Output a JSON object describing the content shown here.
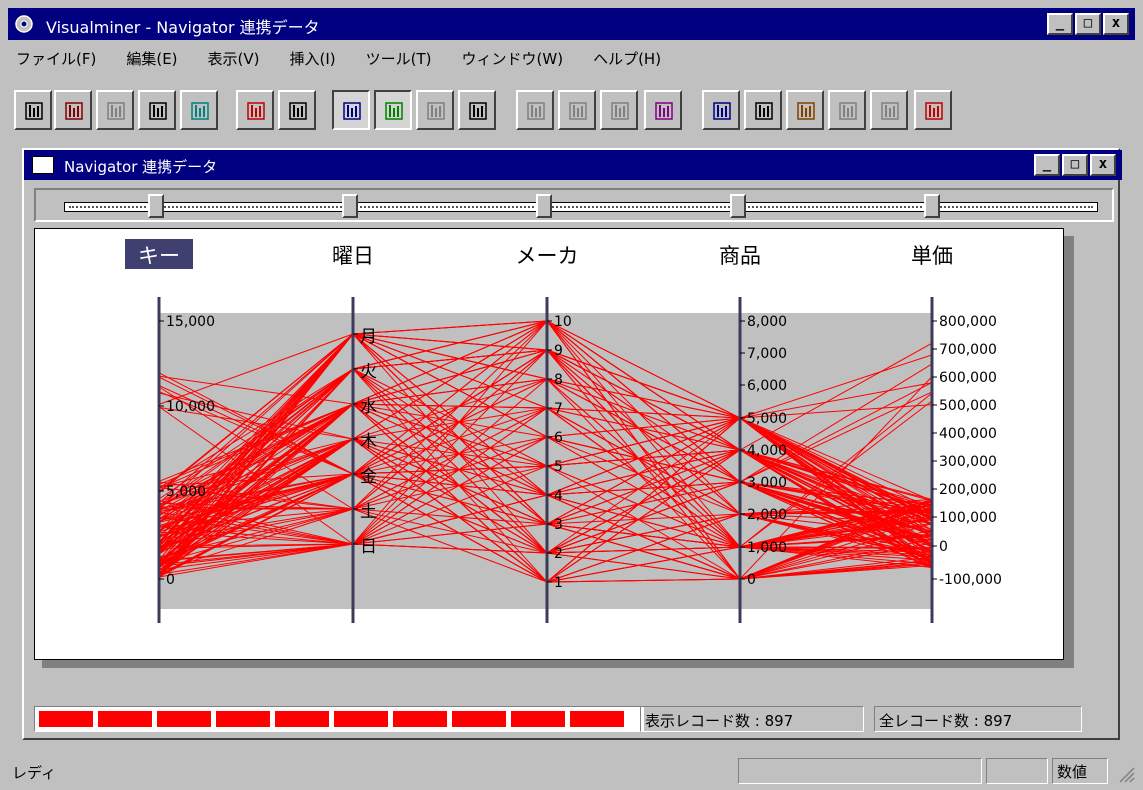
{
  "window": {
    "title": "Visualminer - Navigator 連携データ",
    "buttons": [
      "_",
      "□",
      "x"
    ]
  },
  "menu": [
    "ファイル(F)",
    "編集(E)",
    "表示(V)",
    "挿入(I)",
    "ツール(T)",
    "ウィンドウ(W)",
    "ヘルプ(H)"
  ],
  "toolbar": {
    "icons": [
      "exit-icon",
      "open-folder-icon",
      "disabled-chart-icon",
      "print-icon",
      "data-table-icon",
      "bar-chart-icon",
      "clipboard-icon",
      "parallel-coordinates-icon",
      "color-parallel-icon",
      "disabled-parallel-icon",
      "table-icon",
      "disabled-zoom-icon",
      "disabled-zoom-icon-2",
      "disabled-filter-icon",
      "axis-select-icon",
      "cluster-chart-icon",
      "window-icon",
      "brush-icon",
      "disabled-query-icon",
      "disabled-report-icon",
      "vm-logo-icon"
    ],
    "pressed": [
      7,
      8
    ]
  },
  "child": {
    "title": "Navigator 連携データ"
  },
  "axes": [
    {
      "name": "キー",
      "selected": true,
      "ticks": [
        "15,000",
        "10,000",
        "5,000",
        "0"
      ]
    },
    {
      "name": "曜日",
      "selected": false,
      "ticks": [
        "月",
        "火",
        "水",
        "木",
        "金",
        "土",
        "日"
      ]
    },
    {
      "name": "メーカ",
      "selected": false,
      "ticks": [
        "10",
        "9",
        "8",
        "7",
        "6",
        "5",
        "4",
        "3",
        "2",
        "1"
      ]
    },
    {
      "name": "商品",
      "selected": false,
      "ticks": [
        "8,000",
        "7,000",
        "6,000",
        "5,000",
        "4,000",
        "3,000",
        "2,000",
        "1,000",
        "0"
      ]
    },
    {
      "name": "単価",
      "selected": false,
      "ticks": [
        "800,000",
        "700,000",
        "600,000",
        "500,000",
        "400,000",
        "300,000",
        "200,000",
        "100,000",
        "0",
        "-100,000"
      ]
    }
  ],
  "colors": {
    "lines": "#ff0000",
    "axis": "#3c3c5a",
    "band": "#c0c0c0",
    "title": "#000080"
  },
  "progress": {
    "cells": 10,
    "fraction": 1.0
  },
  "counts": {
    "display": "表示レコード数 : 897",
    "total": "全レコード数 : 897"
  },
  "status": {
    "text": "レディ",
    "num": "数値"
  }
}
